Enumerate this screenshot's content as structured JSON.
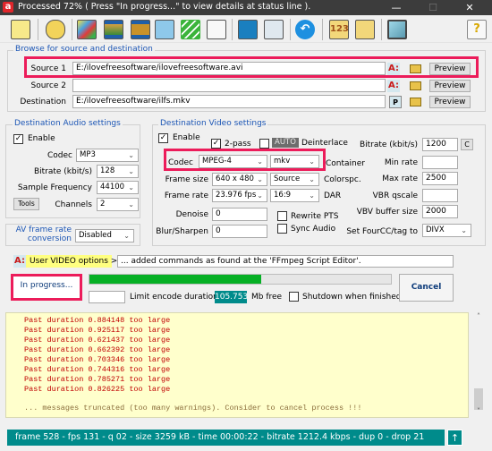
{
  "window": {
    "title": "Processed  72%  ( Press \"In progress...\" to view details at status line ).",
    "logo_letter": "a",
    "minimize": "—",
    "maximize": "☐",
    "close": "✕"
  },
  "toolbar": {
    "buttons": [
      {
        "name": "batch-window-icon"
      },
      {
        "name": "cd-folder-icon"
      },
      {
        "name": "audio-wave-icon"
      },
      {
        "name": "video-film-icon"
      },
      {
        "name": "video-edit-film-icon"
      },
      {
        "name": "script-editor-icon"
      },
      {
        "name": "ffmpeg-logo-icon"
      },
      {
        "name": "notepad-pencil-icon"
      },
      {
        "name": "audio-spectrum-icon"
      },
      {
        "name": "printer-icon"
      },
      {
        "name": "undo-arrow-icon"
      },
      {
        "name": "numbered-film-icon"
      },
      {
        "name": "tools-film-icon"
      },
      {
        "name": "monitor-icon"
      },
      {
        "name": "help-icon"
      }
    ]
  },
  "browse": {
    "title": "Browse for source and destination",
    "source1_label": "Source 1",
    "source1_value": "E:/ilovefreesoftware/ilovefreesoftware.avi",
    "source2_label": "Source 2",
    "source2_value": "",
    "destination_label": "Destination",
    "destination_value": "E:/ilovefreesoftware/ilfs.mkv",
    "ax_label": "A:",
    "p_label": "P",
    "preview_label": "Preview"
  },
  "audio": {
    "title": "Destination Audio settings",
    "enable_label": "Enable",
    "enable_checked": true,
    "codec_label": "Codec",
    "codec_value": "MP3",
    "bitrate_label": "Bitrate (kbit/s)",
    "bitrate_value": "128",
    "samplefreq_label": "Sample Frequency",
    "samplefreq_value": "44100",
    "tools_label": "Tools",
    "channels_label": "Channels",
    "channels_value": "2"
  },
  "avframe": {
    "label_line1": "AV frame rate",
    "label_line2": "conversion",
    "value": "Disabled"
  },
  "video": {
    "title": "Destination Video settings",
    "enable_label": "Enable",
    "enable_checked": true,
    "twopass_label": "2-pass",
    "twopass_checked": true,
    "auto_label": "AUTO",
    "deinterlace_label": "Deinterlace",
    "codec_label": "Codec",
    "codec_value": "MPEG-4",
    "container_value": "mkv",
    "container_label": "Container",
    "framesize_label": "Frame size",
    "framesize_value": "640 x 480",
    "colorspace_value": "Source",
    "colorspace_label": "Colorspc.",
    "framerate_label": "Frame rate",
    "framerate_value": "23.976 fps",
    "dar_value": "16:9",
    "dar_label": "DAR",
    "denoise_label": "Denoise",
    "denoise_value": "0",
    "blur_label": "Blur/Sharpen",
    "blur_value": "0",
    "rewrite_pts_label": "Rewrite PTS",
    "sync_audio_label": "Sync Audio",
    "bitrate_label": "Bitrate (kbit/s)",
    "bitrate_value": "1200",
    "c_label": "C",
    "minrate_label": "Min rate",
    "minrate_value": "",
    "maxrate_label": "Max rate",
    "maxrate_value": "2500",
    "vbr_label": "VBR qscale",
    "vbr_value": "",
    "vbv_label": "VBV buffer size",
    "vbv_value": "2000",
    "fourcc_label": "Set FourCC/tag to",
    "fourcc_value": "DIVX"
  },
  "user_options": {
    "ax_label": "A:",
    "button_label": "User VIDEO options >",
    "text": "... added commands as found at the 'FFmpeg Script Editor'."
  },
  "progress": {
    "in_progress_label": "In progress...",
    "percent": 57,
    "limit_value": "",
    "limit_label": "Limit encode duration",
    "mb_free_value": "105.753",
    "mb_free_label": "Mb free",
    "shutdown_label": "Shutdown when finished",
    "cancel_label": "Cancel"
  },
  "log": {
    "lines": [
      "Past duration 0.884148 too large",
      "Past duration 0.925117 too large",
      "Past duration 0.621437 too large",
      "Past duration 0.662392 too large",
      "Past duration 0.703346 too large",
      "Past duration 0.744316 too large",
      "Past duration 0.785271 too large",
      "Past duration 0.826225 too large"
    ],
    "truncated": "... messages truncated (too many warnings). Consider to cancel process !!!"
  },
  "status": {
    "text": "frame 528 - fps 131 - q 02 - size 3259 kB - time 00:00:22 - bitrate 1212.4 kbps - dup 0 - drop 21",
    "up_arrow": "↑"
  }
}
